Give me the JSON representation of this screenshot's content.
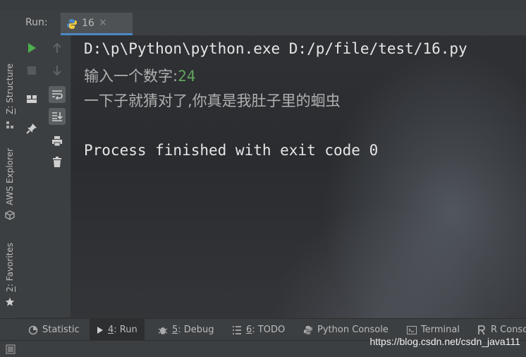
{
  "run_header": {
    "label": "Run:",
    "tab_label": "16",
    "tab_close": "×"
  },
  "left_strip": {
    "structure": {
      "prefix": "Z",
      "rest": ": Structure"
    },
    "aws": "AWS Explorer",
    "favorites": {
      "prefix": "2",
      "rest": ": Favorites"
    }
  },
  "console": {
    "command": "D:\\p\\Python\\python.exe D:/p/file/test/16.py",
    "prompt": "输入一个数字:",
    "input_value": "24",
    "response": "一下子就猜对了,你真是我肚子里的蛔虫",
    "exit_message": "Process finished with exit code 0"
  },
  "bottom_tabs": [
    {
      "label": "Statistic"
    },
    {
      "key": "4",
      "rest": ": Run"
    },
    {
      "key": "5",
      "rest": ": Debug"
    },
    {
      "key": "6",
      "rest": ": TODO"
    },
    {
      "label": "Python Console"
    },
    {
      "label": "Terminal"
    },
    {
      "label": "R Conso"
    }
  ],
  "watermark": "https://blog.csdn.net/csdn_java111",
  "colors": {
    "accent": "#4a88c7",
    "run_green": "#4caf50",
    "input_green": "#62a35d"
  }
}
